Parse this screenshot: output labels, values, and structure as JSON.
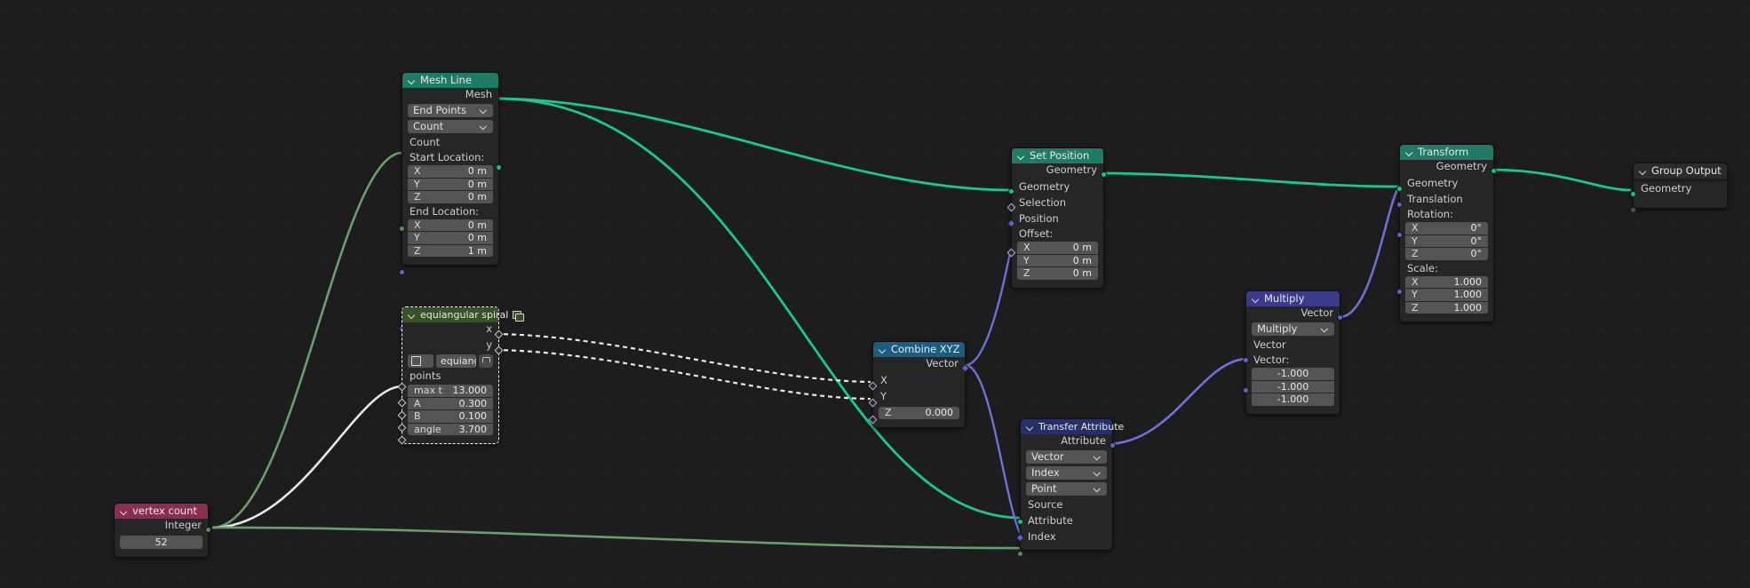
{
  "app": {
    "editor": "Geometry Node Editor",
    "background": "#1d1d1d"
  },
  "colors": {
    "geometry_header": "#1f7a66",
    "group_header": "#3a5324",
    "vector_header": "#3b3b8c",
    "converter_header": "#1c5e82",
    "attribute_header": "#253066",
    "input_header": "#8c2c50",
    "output_header": "#2c2c2c",
    "geometry_socket": "#00ce7c",
    "vector_socket": "#6363c7",
    "integer_socket": "#598c5c",
    "link_geometry": "#17c98a",
    "link_vector": "#7070d8",
    "link_field": "#e8e8e8",
    "link_integer": "#6a9e6d"
  },
  "nodes": {
    "mesh_line": {
      "title": "Mesh Line",
      "outputs": [
        "Mesh"
      ],
      "mode_primary": "End Points",
      "mode_secondary": "Count",
      "inputs": [
        "Count"
      ],
      "start_label": "Start Location:",
      "start": [
        {
          "axis": "X",
          "value": "0 m"
        },
        {
          "axis": "Y",
          "value": "0 m"
        },
        {
          "axis": "Z",
          "value": "0 m"
        }
      ],
      "end_label": "End Location:",
      "end": [
        {
          "axis": "X",
          "value": "0 m"
        },
        {
          "axis": "Y",
          "value": "0 m"
        },
        {
          "axis": "Z",
          "value": "1 m"
        }
      ]
    },
    "equiangular_spiral": {
      "title": "equiangular spiral",
      "outputs": [
        "x",
        "y"
      ],
      "datablock_name": "equiangul..",
      "inputs": [
        "points"
      ],
      "params": [
        {
          "name": "max t",
          "value": "13.000"
        },
        {
          "name": "A",
          "value": "0.300"
        },
        {
          "name": "B",
          "value": "0.100"
        },
        {
          "name": "angle",
          "value": "3.700"
        }
      ]
    },
    "combine_xyz": {
      "title": "Combine XYZ",
      "outputs": [
        "Vector"
      ],
      "inputs": [
        "X",
        "Y"
      ],
      "z": {
        "name": "Z",
        "value": "0.000"
      }
    },
    "set_position": {
      "title": "Set Position",
      "outputs": [
        "Geometry"
      ],
      "inputs": [
        "Geometry",
        "Selection",
        "Position"
      ],
      "offset_label": "Offset:",
      "offset": [
        {
          "axis": "X",
          "value": "0 m"
        },
        {
          "axis": "Y",
          "value": "0 m"
        },
        {
          "axis": "Z",
          "value": "0 m"
        }
      ]
    },
    "transfer_attribute": {
      "title": "Transfer Attribute",
      "outputs": [
        "Attribute"
      ],
      "data_type": "Vector",
      "mapping": "Index",
      "domain": "Point",
      "inputs": [
        "Source",
        "Attribute",
        "Index"
      ]
    },
    "multiply": {
      "title": "Multiply",
      "outputs": [
        "Vector"
      ],
      "operation": "Multiply",
      "input_socket": "Vector",
      "vector_label": "Vector:",
      "vector": [
        "-1.000",
        "-1.000",
        "-1.000"
      ]
    },
    "transform": {
      "title": "Transform",
      "outputs": [
        "Geometry"
      ],
      "inputs": [
        "Geometry",
        "Translation"
      ],
      "rotation_label": "Rotation:",
      "rotation": [
        {
          "axis": "X",
          "value": "0°"
        },
        {
          "axis": "Y",
          "value": "0°"
        },
        {
          "axis": "Z",
          "value": "0°"
        }
      ],
      "scale_label": "Scale:",
      "scale": [
        {
          "axis": "X",
          "value": "1.000"
        },
        {
          "axis": "Y",
          "value": "1.000"
        },
        {
          "axis": "Z",
          "value": "1.000"
        }
      ]
    },
    "group_output": {
      "title": "Group Output",
      "inputs": [
        "Geometry"
      ]
    },
    "vertex_count": {
      "title": "vertex count",
      "outputs": [
        "Integer"
      ],
      "value": "52"
    }
  }
}
